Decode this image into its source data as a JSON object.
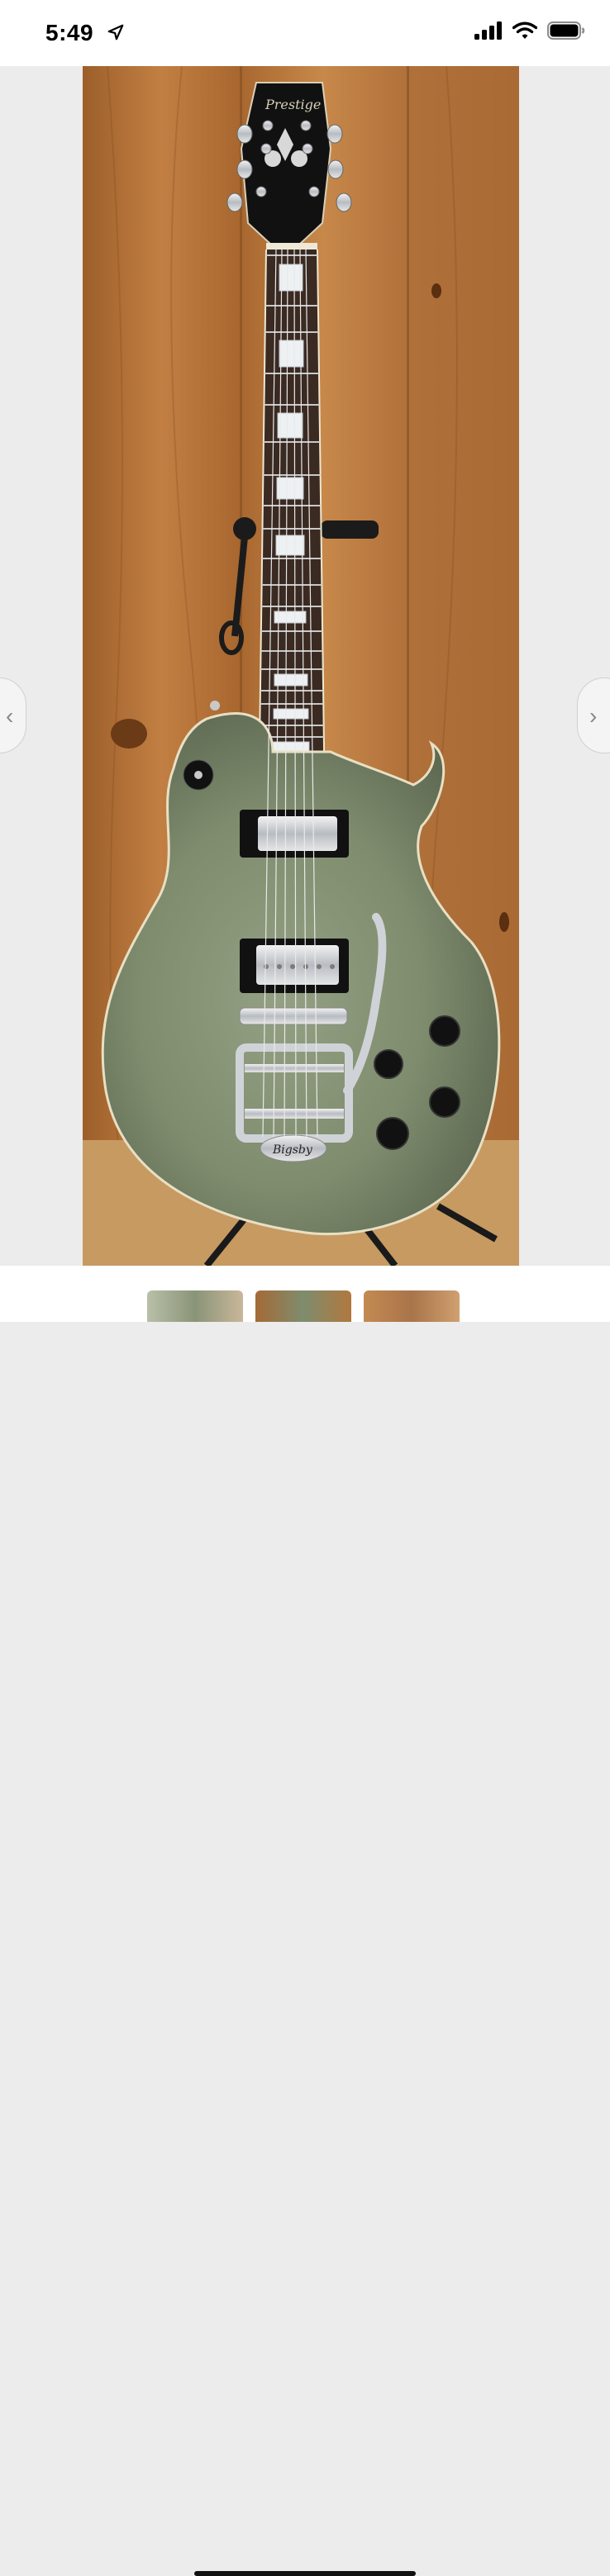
{
  "status_bar": {
    "time": "5:49",
    "icons": [
      "location-arrow-icon",
      "cellular-signal-icon",
      "wifi-icon",
      "battery-icon"
    ]
  },
  "viewer": {
    "image_subject": "electric guitar",
    "headstock_brand": "Prestige",
    "tailpiece_brand": "Bigsby",
    "background_color": "#ececec",
    "body_color": "#7f8c6e",
    "wood_color": "#b9783e"
  },
  "navigation": {
    "prev_icon": "chevron-left-icon",
    "next_icon": "chevron-right-icon",
    "prev_glyph": "‹",
    "next_glyph": "›"
  },
  "thumbnails": {
    "count": 3
  }
}
